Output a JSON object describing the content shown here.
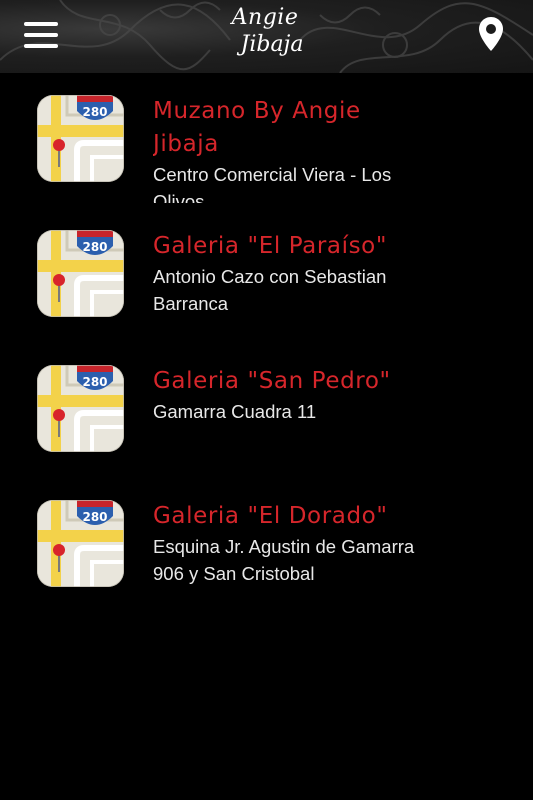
{
  "header": {
    "logo_line1": "Angie",
    "logo_line2": "Jibaja",
    "menu_icon": "hamburger-menu-icon",
    "location_icon": "map-pin-icon"
  },
  "colors": {
    "title": "#d6262b",
    "address": "#e8e8e8",
    "background": "#000000"
  },
  "stores": [
    {
      "title": "Muzano By Angie Jibaja",
      "address": "Centro Comercial Viera - Los Olivos",
      "icon": "maps-app-icon"
    },
    {
      "title": "Galeria \"El Paraíso\"",
      "address": "Antonio Cazo con Sebastian Barranca",
      "icon": "maps-app-icon"
    },
    {
      "title": "Galeria \"San Pedro\"",
      "address": "Gamarra Cuadra 11",
      "icon": "maps-app-icon"
    },
    {
      "title": "Galeria \"El Dorado\"",
      "address": "Esquina Jr. Agustin de Gamarra 906 y San Cristobal",
      "icon": "maps-app-icon"
    }
  ],
  "map_icon_label": "280"
}
